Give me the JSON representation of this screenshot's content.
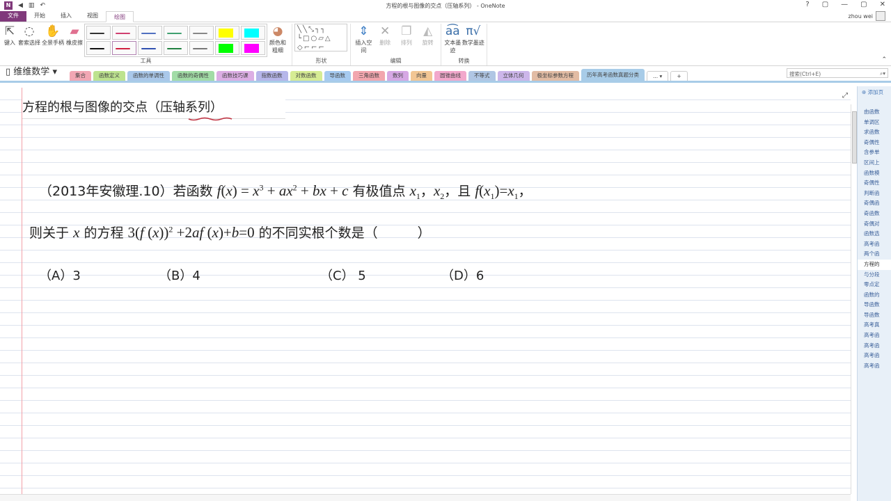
{
  "window": {
    "title": "方程的根与图像的交点（压轴系列） - OneNote",
    "controls": [
      "?",
      "▢",
      "—",
      "▢",
      "✕"
    ],
    "user": "zhou wei"
  },
  "menu": [
    "文件",
    "开始",
    "插入",
    "视图",
    "绘图"
  ],
  "ribbon": {
    "tools": {
      "label": "工具",
      "buttons": [
        "键入",
        "套索选择",
        "全景手柄",
        "橡皮擦"
      ],
      "color_button": "颜色和粗细",
      "pens": [
        "#333333",
        "#d04070",
        "#5070c0",
        "#40a070",
        "#888888",
        "#ffff00",
        "#00ffff",
        "#111111",
        "#d02040",
        "#3050b0",
        "#208040",
        "#777777",
        "#00ff00",
        "#ff00ff"
      ]
    },
    "shapes": {
      "label": "形状"
    },
    "edit": {
      "label": "编辑",
      "buttons": [
        "插入空间",
        "删除",
        "排列",
        "旋转"
      ]
    },
    "convert": {
      "label": "转换",
      "buttons": [
        "文本墨迹",
        "数学墨迹"
      ]
    }
  },
  "notebook": {
    "name": "维维数学",
    "sections": [
      {
        "label": "集合",
        "color": "#f2a7b4"
      },
      {
        "label": "函数定义",
        "color": "#bde38f"
      },
      {
        "label": "函数的单调性",
        "color": "#aac8ea"
      },
      {
        "label": "函数的奇偶性",
        "color": "#a2dca6"
      },
      {
        "label": "函数技巧课",
        "color": "#dcaee4"
      },
      {
        "label": "指数函数",
        "color": "#b6b6ea"
      },
      {
        "label": "对数函数",
        "color": "#d6ec94"
      },
      {
        "label": "导函数",
        "color": "#a6caf0"
      },
      {
        "label": "三角函数",
        "color": "#f2a6ae"
      },
      {
        "label": "数列",
        "color": "#d6a8e4"
      },
      {
        "label": "向量",
        "color": "#f2c694"
      },
      {
        "label": "圆锥曲线",
        "color": "#f2a8cc"
      },
      {
        "label": "不等式",
        "color": "#b0c6e4"
      },
      {
        "label": "立体几何",
        "color": "#ccb6ea"
      },
      {
        "label": "极坐标参数方程",
        "color": "#e2bca4"
      },
      {
        "label": "历年高考函数真题分类",
        "color": "#a8cce8",
        "active": true
      }
    ],
    "more": "... ▾",
    "add": "+"
  },
  "search": {
    "placeholder": "搜索(Ctrl+E)"
  },
  "page": {
    "title": "方程的根与图像的交点（压轴系列）",
    "q_prefix": "（2013年安徽理.10）若函数",
    "q_mid1": "有极值点",
    "q_mid2": "，且",
    "q2_prefix": "则关于",
    "q2_mid": "的方程",
    "q2_suffix": "的不同实根个数是（　　　）",
    "options": [
      "（A）3",
      "（B）4",
      "（C） 5",
      "（D）6"
    ]
  },
  "pages_panel": {
    "add": "添加页",
    "items": [
      "由函数",
      "单调区",
      "求函数",
      "奇偶性",
      "含参单",
      "区间上",
      "函数模",
      "奇偶性",
      "判断函",
      "奇偶函",
      "奇函数",
      "奇偶对",
      "函数选",
      "高考函",
      "两个函",
      "方程的",
      "与分段",
      "零点定",
      "函数的",
      "导函数",
      "导函数",
      "高考真",
      "高考函",
      "高考函",
      "高考函",
      "高考函"
    ],
    "active_index": 15
  }
}
